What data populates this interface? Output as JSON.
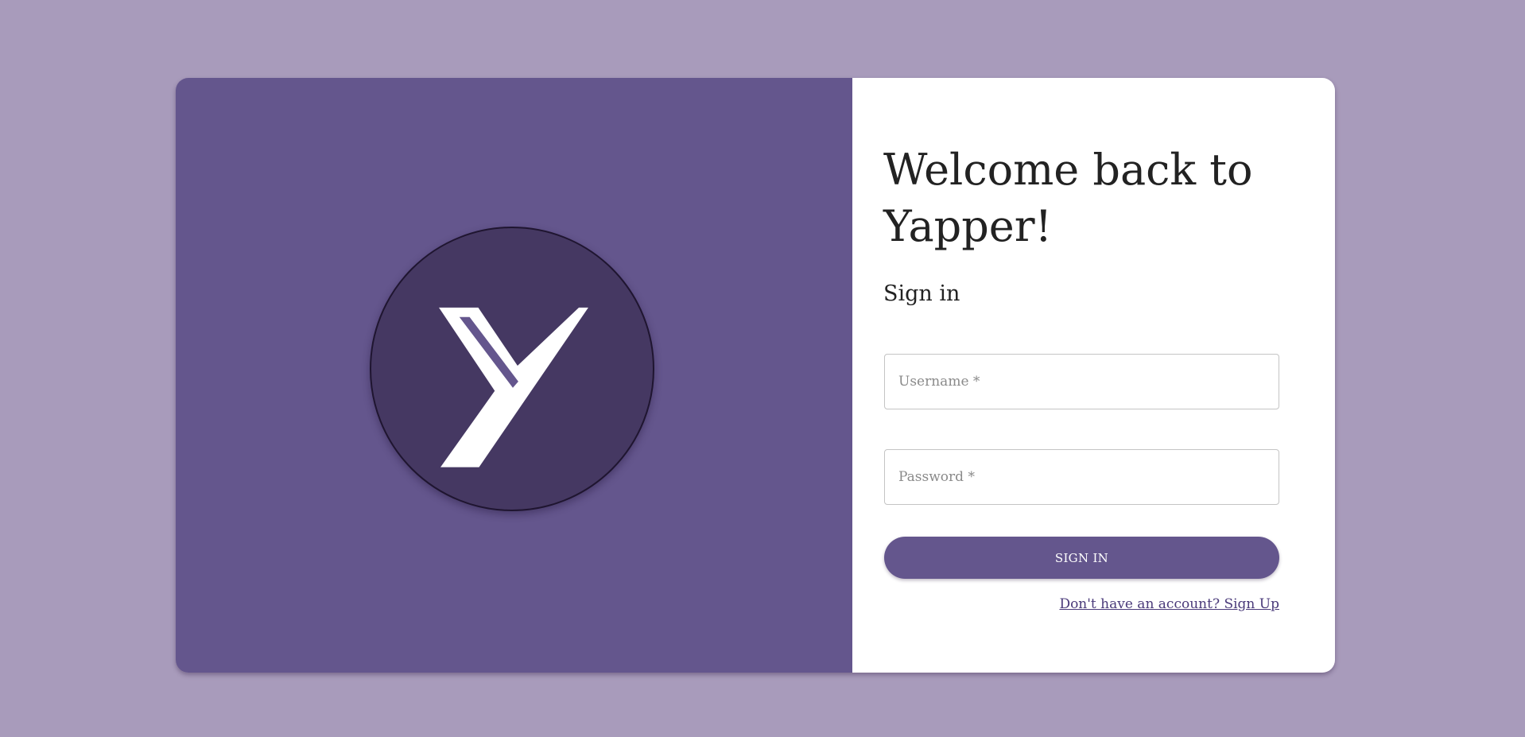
{
  "colors": {
    "page_background": "#a89bbb",
    "brand_panel": "#64568d",
    "logo_circle": "#453862",
    "accent": "#64568d",
    "link": "#4a3a7a"
  },
  "brand": {
    "logo_icon": "yapper-y-logo-icon"
  },
  "login": {
    "title": "Welcome back to Yapper!",
    "subtitle": "Sign in",
    "username_placeholder": "Username *",
    "password_placeholder": "Password *",
    "submit_label": "SIGN IN",
    "signup_link": "Don't have an account? Sign Up"
  }
}
